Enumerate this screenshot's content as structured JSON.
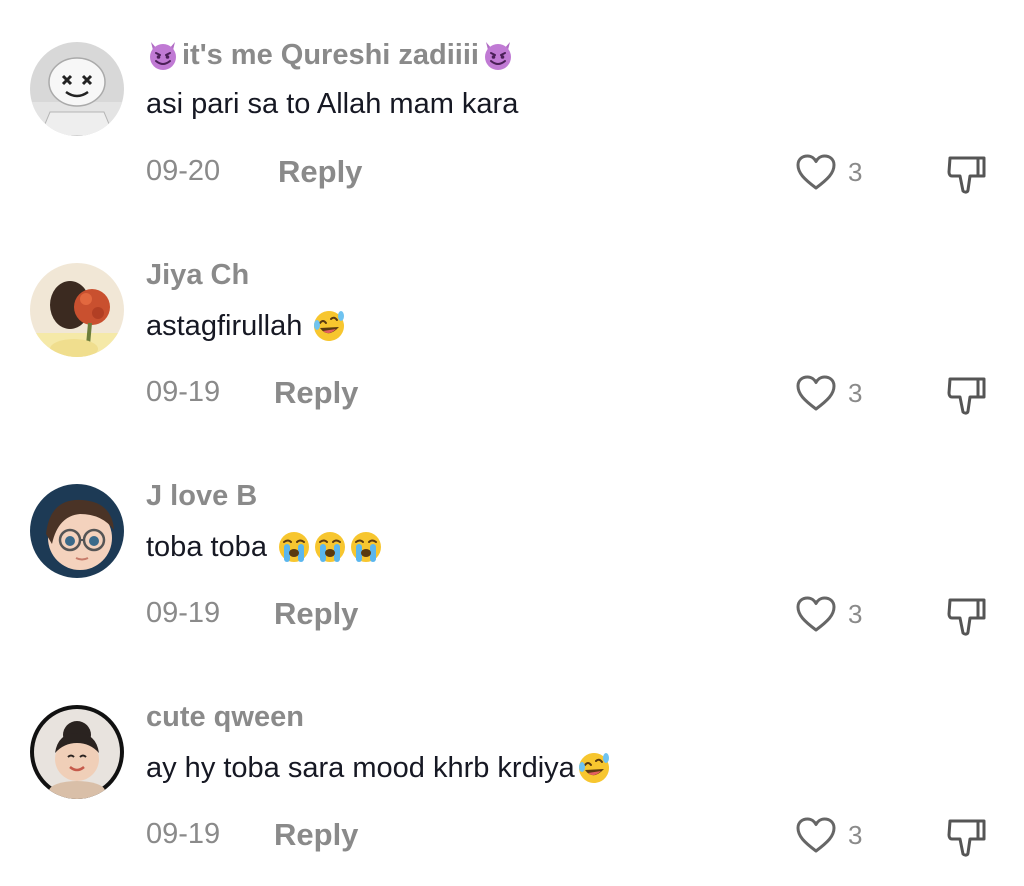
{
  "comments": [
    {
      "username": "it's me Qureshi zadiiii",
      "text": "asi pari sa to Allah mam kara",
      "date": "09-20",
      "reply_label": "Reply",
      "likes": "3",
      "username_emoji": "smiling-devil-emoji",
      "text_emoji": []
    },
    {
      "username": "Jiya Ch",
      "text": "astagfirullah",
      "date": "09-19",
      "reply_label": "Reply",
      "likes": "3",
      "text_emoji": [
        "rolling-laughing-emoji"
      ]
    },
    {
      "username": "J love B",
      "text": "toba toba",
      "date": "09-19",
      "reply_label": "Reply",
      "likes": "3",
      "text_emoji": [
        "loudly-crying-emoji",
        "loudly-crying-emoji",
        "loudly-crying-emoji"
      ]
    },
    {
      "username": "cute qween",
      "text": "ay hy toba sara mood khrb krdiya",
      "date": "09-19",
      "reply_label": "Reply",
      "likes": "3",
      "text_emoji": [
        "rolling-laughing-emoji"
      ]
    }
  ],
  "colors": {
    "muted_text": "#8a8a8a",
    "body_text": "#161823",
    "background": "#ffffff"
  },
  "icons": {
    "like": "heart-outline-icon",
    "dislike": "thumbs-down-outline-icon"
  }
}
